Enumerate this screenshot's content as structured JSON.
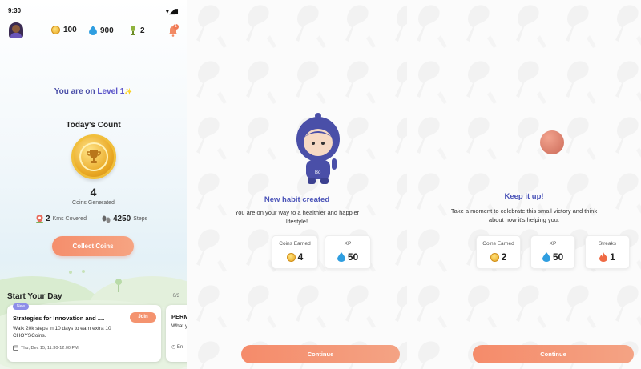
{
  "status": {
    "time": "9:30"
  },
  "topbar": {
    "coins": "100",
    "drops": "900",
    "trophies": "2",
    "bell_count": "1"
  },
  "home": {
    "level_prefix": "You are on ",
    "level_label": "Level 1",
    "sparkle": "✨",
    "today_title": "Today's Count",
    "coins_generated": "4",
    "coins_generated_label": "Coins Generated",
    "kms_value": "2",
    "kms_label": "Kms Covered",
    "steps_value": "4250",
    "steps_label": "Steps",
    "collect_button": "Collect Coins",
    "start_title": "Start Your Day",
    "progress": "0/3"
  },
  "cards": [
    {
      "badge": "New",
      "title": "Strategies for Innovation and ....",
      "join": "Join",
      "description": "Walk 20k steps in 10 days to earn extra 10 CHOYSCoins.",
      "date": "Thu, Dec 15, 11:30-12:00 PM"
    },
    {
      "title": "PERM",
      "description": "What you fi",
      "date": "En"
    }
  ],
  "habit": {
    "mascot_tag": "Bo",
    "title": "New habit created",
    "subtitle": "You are on your way to a healthier and happier lifestyle!",
    "coins_label": "Coins Earned",
    "coins_value": "4",
    "xp_label": "XP",
    "xp_value": "50",
    "continue": "Continue"
  },
  "keepup": {
    "title": "Keep it up!",
    "subtitle": "Take a moment to celebrate this small victory and think about how it's helping you.",
    "coins_label": "Coins Earned",
    "coins_value": "2",
    "xp_label": "XP",
    "xp_value": "50",
    "streaks_label": "Streaks",
    "streaks_value": "1",
    "continue": "Continue"
  },
  "colors": {
    "accent": "#f58e6c",
    "brand_blue": "#4b54b8",
    "mascot": "#4a4fa8"
  },
  "icons": [
    "avatar",
    "coin-icon",
    "drop-icon",
    "trophy-icon",
    "bell-icon",
    "location-pin-icon",
    "footsteps-icon",
    "calendar-icon",
    "flame-icon",
    "clock-icon"
  ]
}
